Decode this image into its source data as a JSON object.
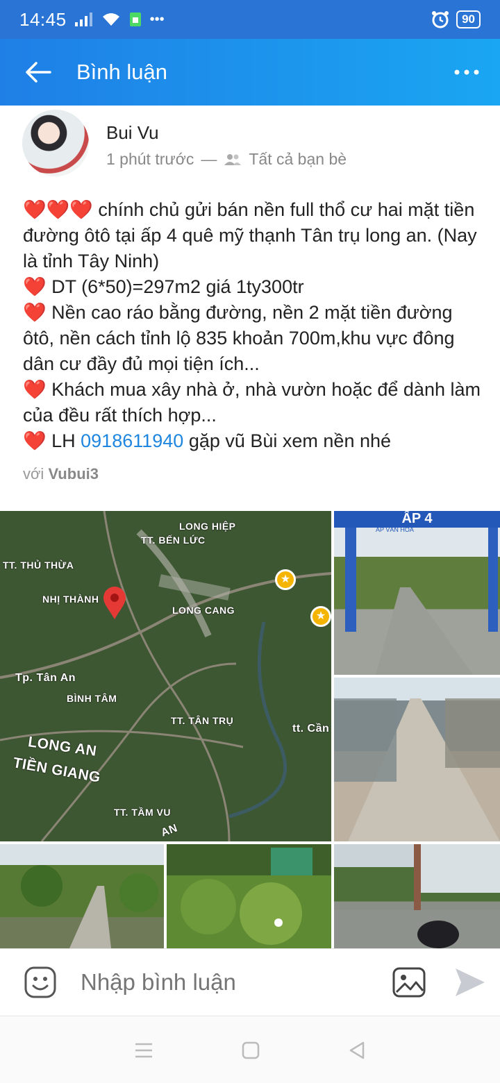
{
  "status_bar": {
    "time": "14:45",
    "battery": "90"
  },
  "app_bar": {
    "title": "Bình luận"
  },
  "post": {
    "author": "Bui Vu",
    "time": "1 phút trước",
    "separator": "—",
    "audience": "Tất cả bạn bè",
    "lines": [
      "❤️❤️❤️ chính chủ gửi bán nền full thổ cư hai mặt tiền đường ôtô tại ấp 4 quê mỹ thạnh Tân trụ long an. (Nay là tỉnh Tây Ninh)",
      "❤️ DT (6*50)=297m2 giá 1ty300tr",
      "❤️ Nền cao ráo bằng đường, nền 2 mặt tiền đường ôtô, nền cách tỉnh lộ 835 khoản 700m,khu vực đông dân cư đầy đủ mọi tiện ích...",
      "❤️ Khách mua xây nhà ở, nhà vườn hoặc để dành làm của đều rất thích hợp..."
    ],
    "contact_prefix": "❤️ LH ",
    "phone": "0918611940",
    "contact_suffix": " gặp vũ Bùi xem nền nhé",
    "tag_prefix": "với",
    "tag_name": "Vubui3"
  },
  "map_labels": {
    "long_hiep": "LONG HIỆP",
    "tt_ben_luc": "TT. BẾN LỨC",
    "tt_thu_thua": "TT. THỦ THỪA",
    "nhi_thanh": "NHỊ THÀNH",
    "long_cang": "LONG CANG",
    "tp_tan_an": "Tp. Tân An",
    "binh_tam": "BÌNH TÂM",
    "tt_tan_tru": "TT. TÂN TRỤ",
    "tt_can": "tt. Cần",
    "long_an": "LONG AN",
    "tien_giang": "TIỀN GIANG",
    "tt_tam_vu": "TT. TẦM VU",
    "an": "AN"
  },
  "photo_labels": {
    "gate_text": "ẤP 4",
    "gate_subtext": "ẤP VĂN HÓA"
  },
  "composer": {
    "placeholder": "Nhập bình luận"
  },
  "colors": {
    "app_bar_start": "#1f7fe6",
    "app_bar_end": "#1aa6f2",
    "link": "#1f86e0",
    "heart": "#e0202a"
  }
}
